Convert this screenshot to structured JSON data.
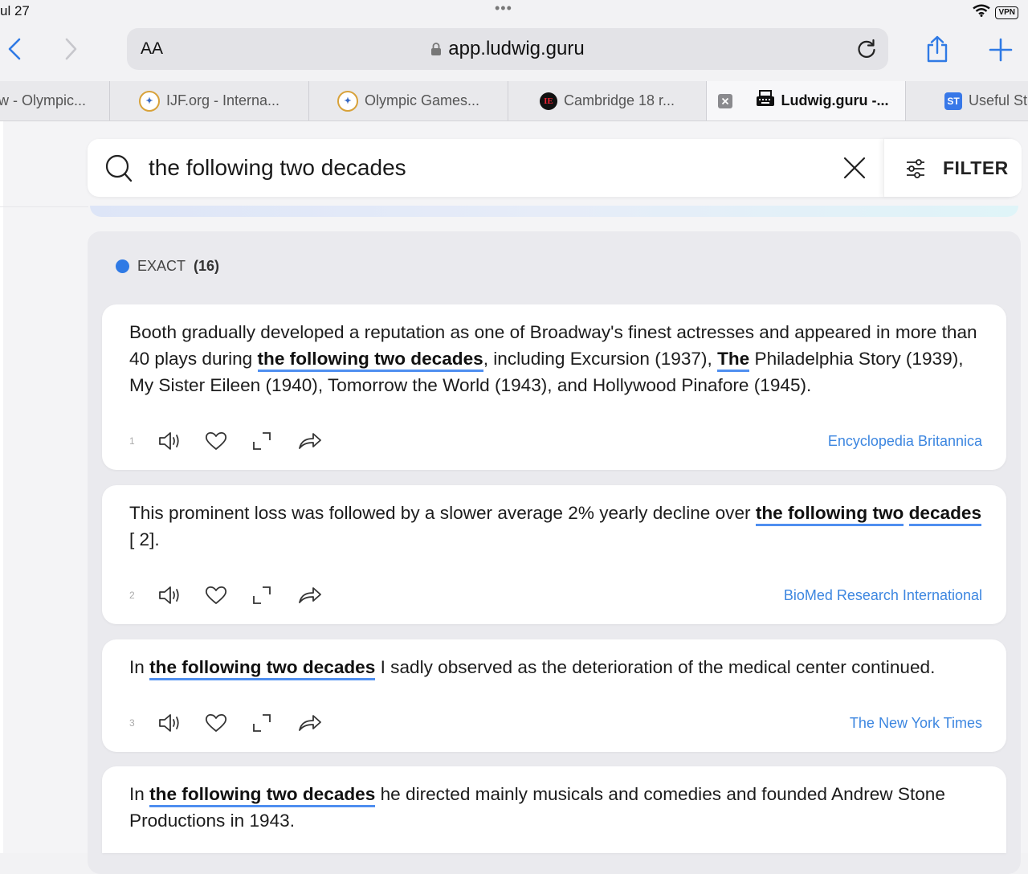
{
  "status": {
    "time": "ul 27",
    "dots": "•••",
    "vpn": "VPN"
  },
  "browser": {
    "text_size_label": "AA",
    "url": "app.ludwig.guru",
    "tabs": [
      {
        "label": "w - Olympic..."
      },
      {
        "label": "IJF.org - Interna..."
      },
      {
        "label": "Olympic Games..."
      },
      {
        "label": "Cambridge 18 r..."
      },
      {
        "label": "Ludwig.guru -...",
        "active": true
      },
      {
        "label": "Useful St"
      }
    ]
  },
  "search": {
    "query": "the following two decades",
    "filter_label": "FILTER"
  },
  "results": {
    "exact_label": "EXACT",
    "exact_count": "(16)",
    "items": [
      {
        "num": "1",
        "parts": [
          "Booth gradually developed a reputation as one of Broadway's finest actresses and appeared in more than 40 plays during ",
          "the following two decades",
          ", including Excursion (1937), ",
          "The",
          " Philadelphia Story (1939), My Sister Eileen (1940), Tomorrow the World (1943), and Hollywood Pinafore (1945)."
        ],
        "source": "Encyclopedia Britannica"
      },
      {
        "num": "2",
        "parts": [
          "This prominent loss was followed by a slower average 2% yearly decline over ",
          "the following two",
          " ",
          "decades",
          " [ 2]."
        ],
        "source": "BioMed Research International"
      },
      {
        "num": "3",
        "parts": [
          "In ",
          "the following two decades",
          " I sadly observed as the deterioration of the medical center continued."
        ],
        "source": "The New York Times"
      },
      {
        "parts": [
          "In ",
          "the following two decades",
          " he directed mainly musicals and comedies and founded Andrew Stone Productions in 1943."
        ]
      }
    ]
  }
}
